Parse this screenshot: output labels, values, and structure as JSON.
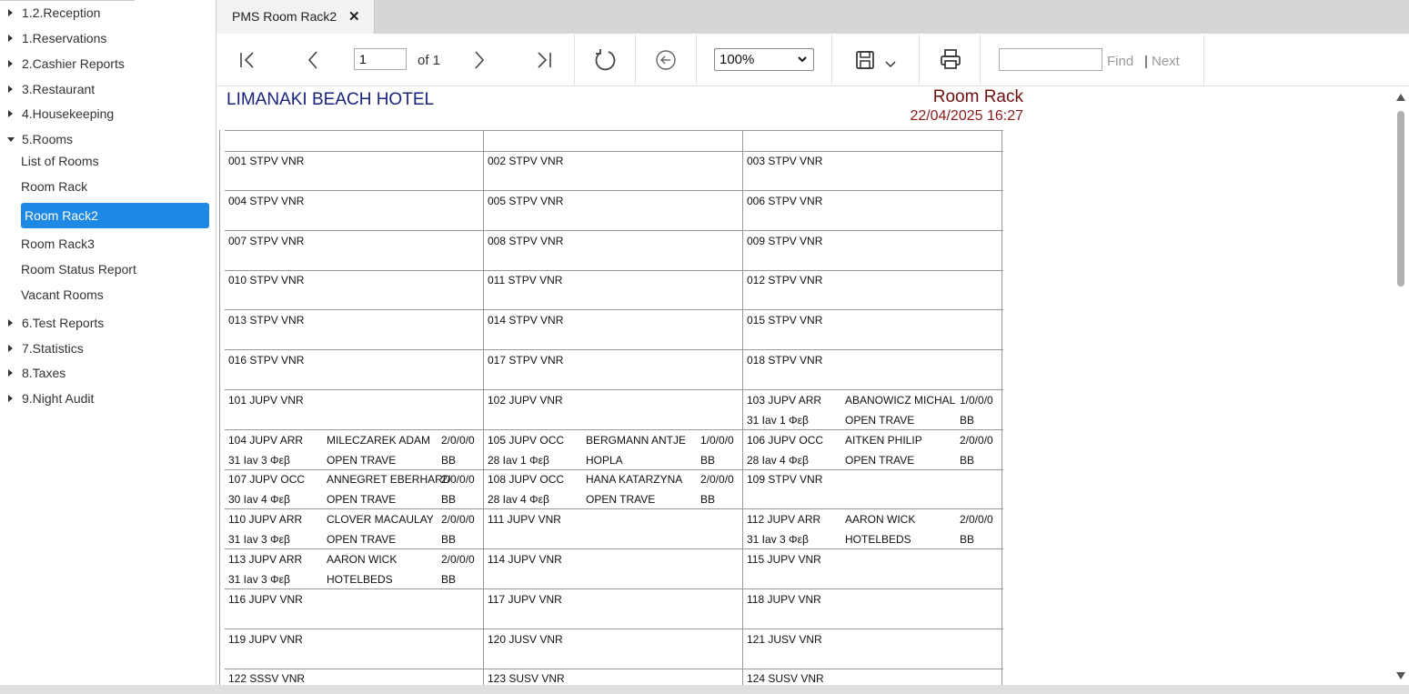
{
  "sidebar": {
    "items": [
      {
        "label": "1.2.Reception"
      },
      {
        "label": "1.Reservations"
      },
      {
        "label": "2.Cashier Reports"
      },
      {
        "label": "3.Restaurant"
      },
      {
        "label": "4.Housekeeping"
      },
      {
        "label": "5.Rooms"
      },
      {
        "label": "6.Test Reports"
      },
      {
        "label": "7.Statistics"
      },
      {
        "label": "8.Taxes"
      },
      {
        "label": "9.Night Audit"
      }
    ],
    "rooms_children": [
      {
        "label": "List of Rooms"
      },
      {
        "label": "Room Rack"
      },
      {
        "label": "Room Rack2"
      },
      {
        "label": "Room Rack3"
      },
      {
        "label": "Room Status Report"
      },
      {
        "label": "Vacant Rooms"
      }
    ]
  },
  "tab": {
    "label": "PMS Room Rack2",
    "close": "✕"
  },
  "toolbar": {
    "page_value": "1",
    "page_of": "of 1",
    "zoom": "100%",
    "find_label": "Find",
    "next_sep": "|",
    "next_label": "Next",
    "find_placeholder": ""
  },
  "report": {
    "hotel": "LIMANAKI BEACH HOTEL",
    "title": "Room Rack",
    "datetime": "22/04/2025 16:27",
    "rows": [
      [
        {
          "room": "001 STPV VNR"
        },
        {
          "room": "002 STPV VNR"
        },
        {
          "room": "003 STPV VNR"
        }
      ],
      [
        {
          "room": "004 STPV VNR"
        },
        {
          "room": "005 STPV VNR"
        },
        {
          "room": "006 STPV VNR"
        }
      ],
      [
        {
          "room": "007 STPV VNR"
        },
        {
          "room": "008 STPV VNR"
        },
        {
          "room": "009 STPV VNR"
        }
      ],
      [
        {
          "room": "010 STPV VNR"
        },
        {
          "room": "011 STPV VNR"
        },
        {
          "room": "012 STPV VNR"
        }
      ],
      [
        {
          "room": "013 STPV VNR"
        },
        {
          "room": "014 STPV VNR"
        },
        {
          "room": "015 STPV VNR"
        }
      ],
      [
        {
          "room": "016 STPV VNR"
        },
        {
          "room": "017 STPV VNR"
        },
        {
          "room": "018 STPV VNR"
        }
      ],
      [
        {
          "room": "101 JUPV VNR"
        },
        {
          "room": "102 JUPV VNR"
        },
        {
          "room": "103 JUPV ARR",
          "guest": "ABANOWICZ  MICHAL",
          "pax": "1/0/0/0",
          "stay": "31 Iav  1 Φεβ",
          "agent": "OPEN TRAVE",
          "board": "BB"
        }
      ],
      [
        {
          "room": "104 JUPV ARR",
          "guest": "MILECZAREK ADAM",
          "pax": "2/0/0/0",
          "stay": "31 Iav  3 Φεβ",
          "agent": "OPEN TRAVE",
          "board": "BB"
        },
        {
          "room": "105 JUPV OCC",
          "guest": "BERGMANN  ANTJE",
          "pax": "1/0/0/0",
          "stay": "28 Iav  1 Φεβ",
          "agent": "HOPLA",
          "board": "BB"
        },
        {
          "room": "106 JUPV OCC",
          "guest": "AITKEN  PHILIP",
          "pax": "2/0/0/0",
          "stay": "28 Iav  4 Φεβ",
          "agent": "OPEN TRAVE",
          "board": "BB"
        }
      ],
      [
        {
          "room": "107 JUPV OCC",
          "guest": "ANNEGRET EBERHARD",
          "pax": "2/0/0/0",
          "stay": "30 Iav  4 Φεβ",
          "agent": "OPEN TRAVE",
          "board": "BB"
        },
        {
          "room": "108 JUPV OCC",
          "guest": "HANA KATARZYNA",
          "pax": "2/0/0/0",
          "stay": "28 Iav  4 Φεβ",
          "agent": "OPEN TRAVE",
          "board": "BB"
        },
        {
          "room": "109 STPV VNR"
        }
      ],
      [
        {
          "room": "110 JUPV ARR",
          "guest": "CLOVER MACAULAY",
          "pax": "2/0/0/0",
          "stay": "31 Iav  3 Φεβ",
          "agent": "OPEN TRAVE",
          "board": "BB"
        },
        {
          "room": "111 JUPV VNR"
        },
        {
          "room": "112 JUPV ARR",
          "guest": "AARON WICK",
          "pax": "2/0/0/0",
          "stay": "31 Iav  3 Φεβ",
          "agent": "HOTELBEDS",
          "board": "BB"
        }
      ],
      [
        {
          "room": "113 JUPV ARR",
          "guest": "AARON WICK",
          "pax": "2/0/0/0",
          "stay": "31 Iav  3 Φεβ",
          "agent": "HOTELBEDS",
          "board": "BB"
        },
        {
          "room": "114 JUPV VNR"
        },
        {
          "room": "115 JUPV VNR"
        }
      ],
      [
        {
          "room": "116 JUPV VNR"
        },
        {
          "room": "117 JUPV VNR"
        },
        {
          "room": "118 JUPV VNR"
        }
      ],
      [
        {
          "room": "119 JUPV VNR"
        },
        {
          "room": "120 JUSV VNR"
        },
        {
          "room": "121 JUSV VNR"
        }
      ],
      [
        {
          "room": "122 SSSV VNR"
        },
        {
          "room": "123 SUSV VNR"
        },
        {
          "room": "124 SUSV VNR"
        }
      ]
    ]
  },
  "icons": {
    "first": "first-page-icon",
    "prev": "prev-page-icon",
    "next": "next-page-icon",
    "last": "last-page-icon",
    "refresh": "refresh-icon",
    "back": "back-arrow-icon",
    "save": "save-icon",
    "print": "print-icon"
  },
  "colors": {
    "active_item": "#1e88e5",
    "hotel_title": "#1a237e",
    "report_title": "#6d0f0f"
  }
}
